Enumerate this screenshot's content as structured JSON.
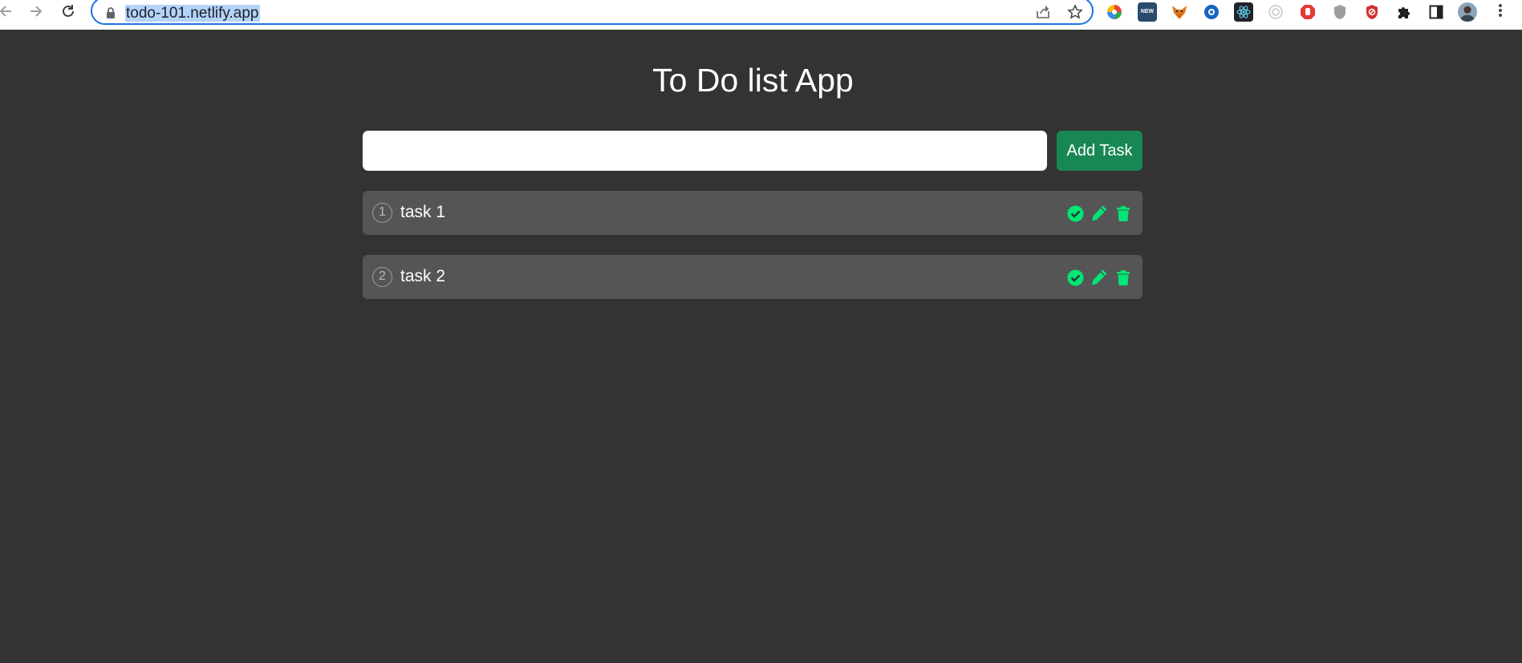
{
  "browser": {
    "url": "todo-101.netlify.app",
    "extensions": [
      "color-wheel-icon",
      "new-badge-icon",
      "fox-icon",
      "blue-circle-icon",
      "react-icon",
      "gray-circle-icon",
      "stop-hand-icon",
      "shield-icon",
      "red-shield-icon",
      "puzzle-icon",
      "sidebar-icon",
      "avatar"
    ],
    "new_badge": "NEW"
  },
  "app": {
    "title": "To Do list App",
    "input": {
      "value": "",
      "placeholder": ""
    },
    "add_button": "Add Task",
    "accent": "#00e676",
    "button_color": "#198754"
  },
  "tasks": [
    {
      "number": "1",
      "label": "task 1"
    },
    {
      "number": "2",
      "label": "task 2"
    }
  ]
}
